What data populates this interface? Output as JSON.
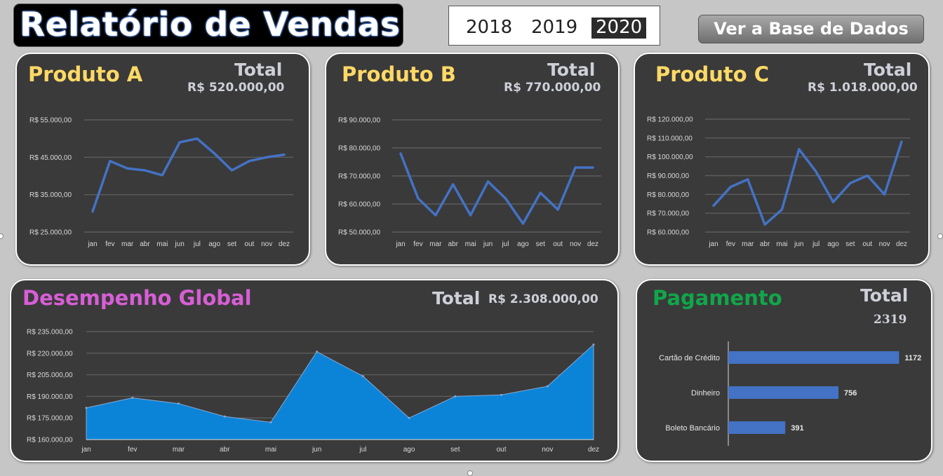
{
  "header": {
    "title": "Relatório de Vendas"
  },
  "year_slicer": {
    "years": [
      "2018",
      "2019",
      "2020"
    ],
    "selected": "2020"
  },
  "db_button": {
    "label": "Ver a Base de Dados"
  },
  "colors": {
    "product_title": "#ffd966",
    "global_title": "#d85ed6",
    "payment_title": "#10a64a",
    "line": "#4472c4",
    "area": "#0b84d8",
    "bar": "#4472c4",
    "card_bg": "#3a3a3a"
  },
  "produto_a": {
    "title": "Produto A",
    "total_label": "Total",
    "total_value": "R$ 520.000,00"
  },
  "produto_b": {
    "title": "Produto B",
    "total_label": "Total",
    "total_value": "R$ 770.000,00"
  },
  "produto_c": {
    "title": "Produto C",
    "total_label": "Total",
    "total_value": "R$ 1.018.000,00"
  },
  "global": {
    "title": "Desempenho Global",
    "total_label": "Total",
    "total_value": "R$ 2.308.000,00"
  },
  "pagamento": {
    "title": "Pagamento",
    "total_label": "Total",
    "total_value": "2319"
  },
  "chart_data": [
    {
      "id": "chart-a",
      "type": "line",
      "categories": [
        "jan",
        "fev",
        "mar",
        "abr",
        "mai",
        "jun",
        "jul",
        "ago",
        "set",
        "out",
        "nov",
        "dez"
      ],
      "series": [
        {
          "values": [
            30500,
            44000,
            42000,
            41500,
            40200,
            49000,
            50000,
            46000,
            41500,
            44000,
            45000,
            45700
          ]
        }
      ],
      "ylim": [
        25000,
        55000
      ],
      "yticks": [
        "R$ 25.000,00",
        "R$ 35.000,00",
        "R$ 45.000,00",
        "R$ 55.000,00"
      ],
      "grid": true
    },
    {
      "id": "chart-b",
      "type": "line",
      "categories": [
        "jan",
        "fev",
        "mar",
        "abr",
        "mai",
        "jun",
        "jul",
        "ago",
        "set",
        "out",
        "nov",
        "dez"
      ],
      "series": [
        {
          "values": [
            78000,
            62000,
            56000,
            67000,
            56000,
            68000,
            62000,
            53000,
            64000,
            58000,
            73000,
            73000
          ]
        }
      ],
      "ylim": [
        50000,
        90000
      ],
      "yticks": [
        "R$ 50.000,00",
        "R$ 60.000,00",
        "R$ 70.000,00",
        "R$ 80.000,00",
        "R$ 90.000,00"
      ],
      "grid": true
    },
    {
      "id": "chart-c",
      "type": "line",
      "categories": [
        "jan",
        "fev",
        "mar",
        "abr",
        "mai",
        "jun",
        "jul",
        "ago",
        "set",
        "out",
        "nov",
        "dez"
      ],
      "series": [
        {
          "values": [
            74000,
            84000,
            88000,
            64000,
            72000,
            104000,
            92000,
            76000,
            86000,
            90000,
            80000,
            108000
          ]
        }
      ],
      "ylim": [
        60000,
        120000
      ],
      "yticks": [
        "R$ 60.000,00",
        "R$ 70.000,00",
        "R$ 80.000,00",
        "R$ 90.000,00",
        "R$ 100.000,00",
        "R$ 110.000,00",
        "R$ 120.000,00"
      ],
      "grid": true
    },
    {
      "id": "chart-global",
      "type": "area",
      "categories": [
        "jan",
        "fev",
        "mar",
        "abr",
        "mai",
        "jun",
        "jul",
        "ago",
        "set",
        "out",
        "nov",
        "dez"
      ],
      "series": [
        {
          "values": [
            182000,
            189000,
            185000,
            176000,
            172000,
            221000,
            204000,
            175000,
            190000,
            191000,
            197000,
            226000
          ]
        }
      ],
      "ylim": [
        160000,
        235000
      ],
      "yticks": [
        "R$ 160.000,00",
        "R$ 175.000,00",
        "R$ 190.000,00",
        "R$ 205.000,00",
        "R$ 220.000,00",
        "R$ 235.000,00"
      ],
      "grid": true
    },
    {
      "id": "chart-pagamento",
      "type": "bar",
      "categories": [
        "Cartão de Crédito",
        "Dinheiro",
        "Boleto Bancário"
      ],
      "values": [
        1172,
        756,
        391
      ],
      "xlim": [
        0,
        1300
      ]
    }
  ]
}
